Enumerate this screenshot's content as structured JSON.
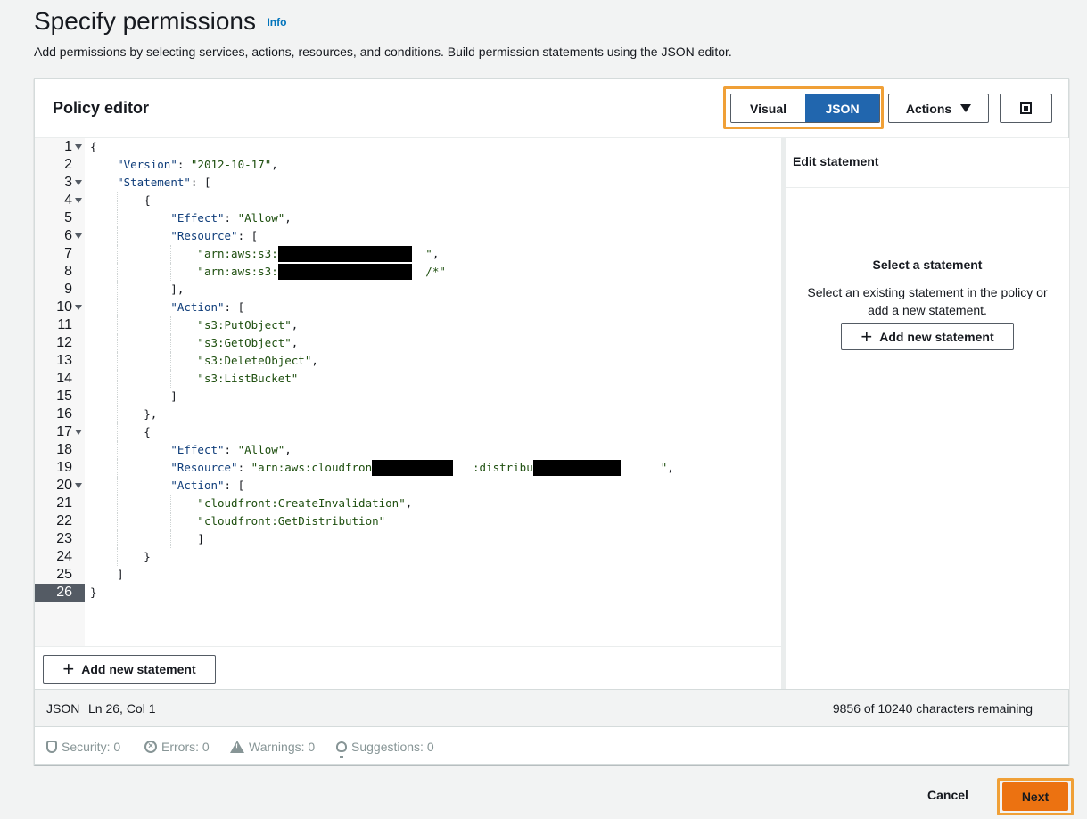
{
  "page": {
    "title": "Specify permissions",
    "info": "Info",
    "description": "Add permissions by selecting services, actions, resources, and conditions. Build permission statements using the JSON editor."
  },
  "editor_panel": {
    "title": "Policy editor",
    "toggle": {
      "visual": "Visual",
      "json": "JSON",
      "selected": "JSON"
    },
    "actions_label": "Actions",
    "add_statement": "Add new statement"
  },
  "code": {
    "active_line": 26,
    "lines": [
      "{",
      "    \"Version\": \"2012-10-17\",",
      "    \"Statement\": [",
      "        {",
      "            \"Effect\": \"Allow\",",
      "            \"Resource\": [",
      "                \"arn:aws:s3:::                    \",",
      "                \"arn:aws:s3:::                    /*\"",
      "            ],",
      "            \"Action\": [",
      "                \"s3:PutObject\",",
      "                \"s3:GetObject\",",
      "                \"s3:DeleteObject\",",
      "                \"s3:ListBucket\"",
      "            ]",
      "        },",
      "        {",
      "            \"Effect\": \"Allow\",",
      "            \"Resource\": \"arn:aws:cloudfront::            :distribution/              \",",
      "            \"Action\": [",
      "                \"cloudfront:CreateInvalidation\",",
      "                \"cloudfront:GetDistribution\"",
      "                ]",
      "        }",
      "    ]",
      "}"
    ]
  },
  "side_panel": {
    "title": "Edit statement",
    "empty_title": "Select a statement",
    "empty_desc": "Select an existing statement in the policy or add a new statement.",
    "add_statement": "Add new statement"
  },
  "status": {
    "mode": "JSON",
    "position": "Ln 26, Col 1",
    "remaining": "9856 of 10240 characters remaining"
  },
  "checks": {
    "security": "Security: 0",
    "errors": "Errors: 0",
    "warnings": "Warnings: 0",
    "suggestions": "Suggestions: 0"
  },
  "footer": {
    "cancel": "Cancel",
    "next": "Next"
  },
  "colors": {
    "accent_blue": "#2166ae",
    "primary_orange": "#ec7211",
    "highlight_orange": "#f0a037"
  }
}
